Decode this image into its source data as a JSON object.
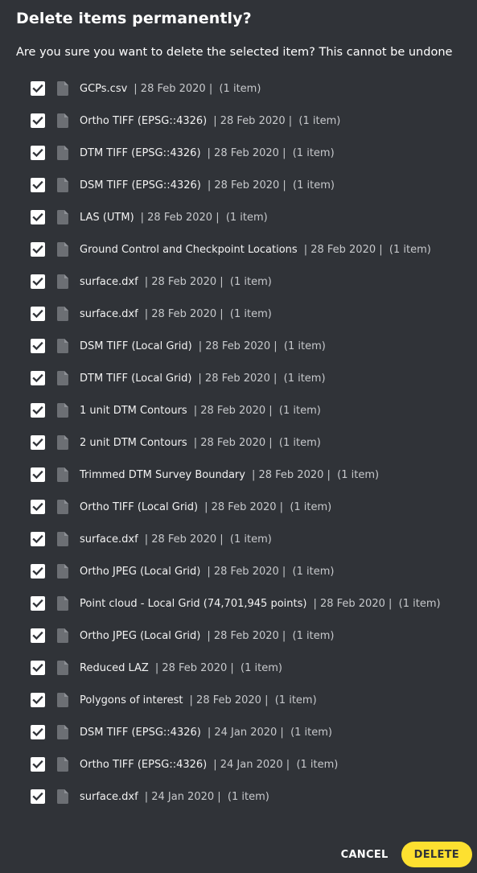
{
  "dialog": {
    "title": "Delete items permanently?",
    "message": "Are you sure you want to delete the selected item? This cannot be undone",
    "cancel_label": "CANCEL",
    "delete_label": "DELETE"
  },
  "colors": {
    "background": "#303338",
    "accent": "#fde030",
    "checkbox": "#ffffff",
    "text_secondary": "#c7c9cc"
  },
  "icons": {
    "checkbox": "check-icon",
    "file": "file-icon"
  },
  "items": [
    {
      "name": "GCPs.csv",
      "meta": "| 28 Feb 2020 |  (1 item)",
      "checked": true
    },
    {
      "name": "Ortho TIFF (EPSG::4326)",
      "meta": "| 28 Feb 2020 |  (1 item)",
      "checked": true
    },
    {
      "name": "DTM TIFF (EPSG::4326)",
      "meta": "| 28 Feb 2020 |  (1 item)",
      "checked": true
    },
    {
      "name": "DSM TIFF (EPSG::4326)",
      "meta": "| 28 Feb 2020 |  (1 item)",
      "checked": true
    },
    {
      "name": "LAS (UTM)",
      "meta": "| 28 Feb 2020 |  (1 item)",
      "checked": true
    },
    {
      "name": "Ground Control and Checkpoint Locations",
      "meta": "| 28 Feb 2020 |  (1 item)",
      "checked": true
    },
    {
      "name": "surface.dxf",
      "meta": "| 28 Feb 2020 |  (1 item)",
      "checked": true
    },
    {
      "name": "surface.dxf",
      "meta": "| 28 Feb 2020 |  (1 item)",
      "checked": true
    },
    {
      "name": "DSM TIFF (Local Grid)",
      "meta": "| 28 Feb 2020 |  (1 item)",
      "checked": true
    },
    {
      "name": "DTM TIFF (Local Grid)",
      "meta": "| 28 Feb 2020 |  (1 item)",
      "checked": true
    },
    {
      "name": "1 unit DTM Contours",
      "meta": "| 28 Feb 2020 |  (1 item)",
      "checked": true
    },
    {
      "name": "2 unit DTM Contours",
      "meta": "| 28 Feb 2020 |  (1 item)",
      "checked": true
    },
    {
      "name": "Trimmed DTM Survey Boundary",
      "meta": "| 28 Feb 2020 |  (1 item)",
      "checked": true
    },
    {
      "name": "Ortho TIFF (Local Grid)",
      "meta": "| 28 Feb 2020 |  (1 item)",
      "checked": true
    },
    {
      "name": "surface.dxf",
      "meta": "| 28 Feb 2020 |  (1 item)",
      "checked": true
    },
    {
      "name": "Ortho JPEG (Local Grid)",
      "meta": "| 28 Feb 2020 |  (1 item)",
      "checked": true
    },
    {
      "name": "Point cloud - Local Grid (74,701,945 points)",
      "meta": "| 28 Feb 2020 |  (1 item)",
      "checked": true
    },
    {
      "name": "Ortho JPEG (Local Grid)",
      "meta": "| 28 Feb 2020 |  (1 item)",
      "checked": true
    },
    {
      "name": "Reduced LAZ",
      "meta": "| 28 Feb 2020 |  (1 item)",
      "checked": true
    },
    {
      "name": "Polygons of interest",
      "meta": "| 28 Feb 2020 |  (1 item)",
      "checked": true
    },
    {
      "name": "DSM TIFF (EPSG::4326)",
      "meta": "| 24 Jan 2020 |  (1 item)",
      "checked": true
    },
    {
      "name": "Ortho TIFF (EPSG::4326)",
      "meta": "| 24 Jan 2020 |  (1 item)",
      "checked": true
    },
    {
      "name": "surface.dxf",
      "meta": "| 24 Jan 2020 |  (1 item)",
      "checked": true
    }
  ]
}
